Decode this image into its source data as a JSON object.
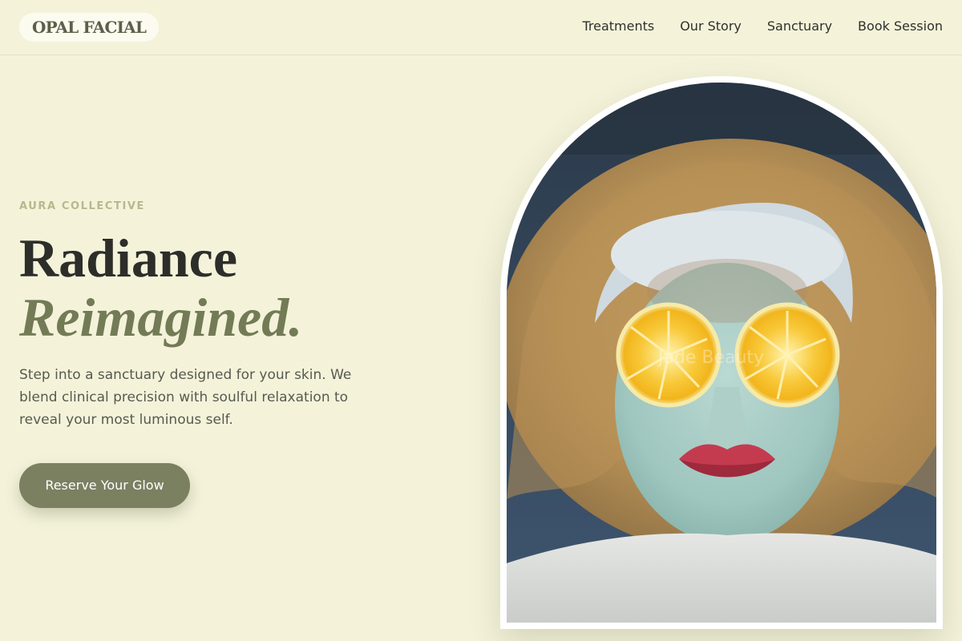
{
  "brand": {
    "logo": "OPAL FACIAL"
  },
  "nav": {
    "items": [
      "Treatments",
      "Our Story",
      "Sanctuary",
      "Book Session"
    ]
  },
  "hero": {
    "eyebrow": "AURA COLLECTIVE",
    "headline_line1": "Radiance",
    "headline_line2": "Reimagined.",
    "description": "Step into a sanctuary designed for your skin. We blend clinical precision with soulful relaxation to reveal your most luminous self.",
    "cta_label": "Reserve Your Glow"
  },
  "image": {
    "subject": "woman with green clay face mask and lemon slices over eyes",
    "watermark": "Jade Beauty"
  },
  "colors": {
    "background": "#f4f3da",
    "accent": "#7b8061",
    "accent_text": "#737b56",
    "eyebrow": "#b9b78e"
  }
}
